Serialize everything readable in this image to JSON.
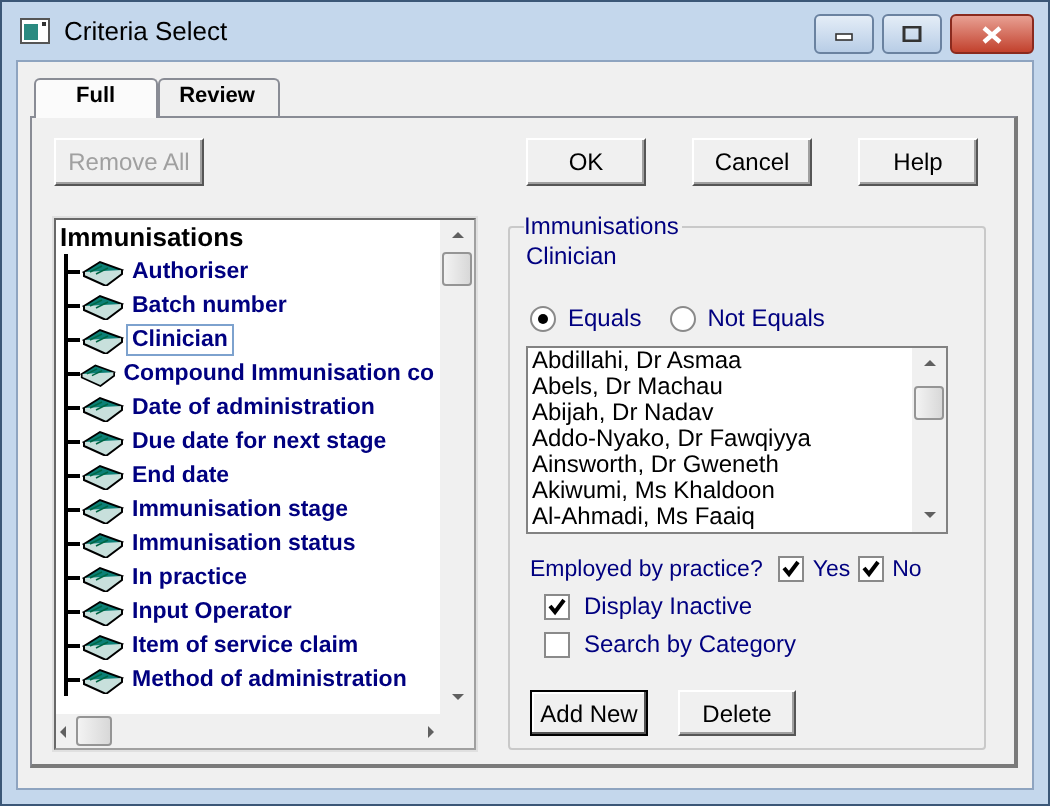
{
  "window": {
    "title": "Criteria Select"
  },
  "tabs": [
    {
      "label": "Full",
      "selected": true
    },
    {
      "label": "Review",
      "selected": false
    }
  ],
  "toolbar": {
    "remove_all": {
      "label": "Remove All",
      "disabled": true
    },
    "buttons": [
      "OK",
      "Cancel",
      "Help"
    ]
  },
  "tree": {
    "label": "Immunisations",
    "children": [
      {
        "label": "Authoriser",
        "selected": false
      },
      {
        "label": "Batch number",
        "selected": false
      },
      {
        "label": "Clinician",
        "selected": true
      },
      {
        "label": "Compound Immunisation co",
        "selected": false
      },
      {
        "label": "Date of administration",
        "selected": false
      },
      {
        "label": "Due date for next stage",
        "selected": false
      },
      {
        "label": "End date",
        "selected": false
      },
      {
        "label": "Immunisation stage",
        "selected": false
      },
      {
        "label": "Immunisation status",
        "selected": false
      },
      {
        "label": "In practice",
        "selected": false
      },
      {
        "label": "Input Operator",
        "selected": false
      },
      {
        "label": "Item of service claim",
        "selected": false
      },
      {
        "label": "Method of administration",
        "selected": false
      }
    ]
  },
  "criteria": {
    "group_title": "Immunisations",
    "field": "Clinician",
    "operators": [
      {
        "label": "Equals",
        "selected": true
      },
      {
        "label": "Not Equals",
        "selected": false
      }
    ],
    "values": [
      "Abdillahi, Dr Asmaa",
      "Abels, Dr Machau",
      "Abijah, Dr Nadav",
      "Addo-Nyako, Dr Fawqiyya",
      "Ainsworth, Dr Gweneth",
      "Akiwumi, Ms Khaldoon",
      "Al-Ahmadi, Ms Faaiq"
    ],
    "employed_label": "Employed by practice?",
    "employed": [
      {
        "label": "Yes",
        "checked": true
      },
      {
        "label": "No",
        "checked": true
      }
    ],
    "options": [
      {
        "label": "Display Inactive",
        "checked": true
      },
      {
        "label": "Search by Category",
        "checked": false
      }
    ],
    "buttons": [
      "Add New",
      "Delete"
    ]
  }
}
